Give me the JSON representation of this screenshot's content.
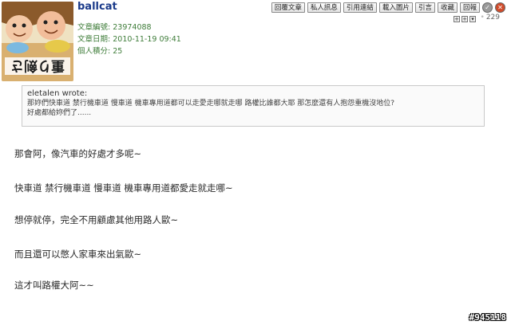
{
  "post": {
    "username": "ballcat",
    "meta": {
      "article_id_label": "文章編號:",
      "article_id": "23974088",
      "date_label": "文章日期:",
      "date": "2010-11-19 09:41",
      "points_label": "個人積分:",
      "points": "25"
    },
    "toolbar": {
      "reply": "回覆文章",
      "private_msg": "私人訊息",
      "quote_link": "引用連結",
      "load_images": "載入圖片",
      "quote": "引言",
      "bookmark": "收藏",
      "report": "回報",
      "ok_icon": "check-icon",
      "delete_icon": "close-icon"
    },
    "reply_count": "229",
    "quote_block": {
      "author": "eletalen wrote:",
      "lines": [
        "那妳們快車道 禁行機車道 慢車道 機車專用道都可以走愛走哪就走哪 路權比誰都大耶 那怎麼還有人抱怨重機沒地位?",
        "好處都給妳們了......"
      ]
    },
    "paragraphs": [
      "那會阿，像汽車的好處才多呢~",
      "快車道 禁行機車道 慢車道 機車專用道都愛走就走哪~",
      "想停就停，完全不用顧慮其他用路人歐~",
      "而且還可以憋人家車來出氣歐~",
      "這才叫路權大阿~~"
    ],
    "post_number": "#945118",
    "avatar_text": "重り劍さ",
    "colors": {
      "username": "#1a3a8a",
      "meta": "#3f7d3a"
    }
  }
}
